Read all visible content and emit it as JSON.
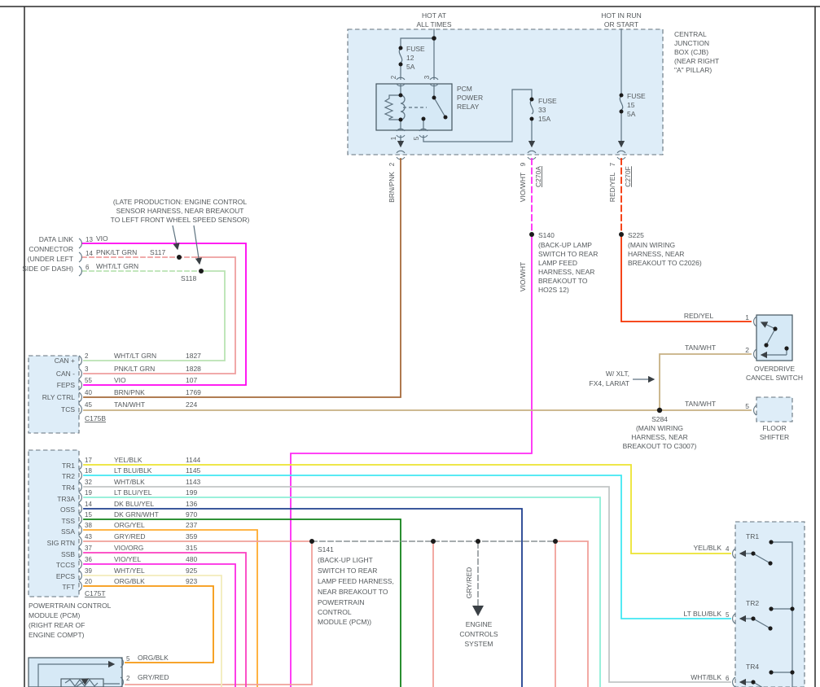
{
  "wire_colors": {
    "vio": "#ff00f0",
    "vio_wht": "#ff2af5",
    "pnk_lt_grn": "#ee9e9e",
    "wht_lt_grn": "#b9e3b2",
    "brn_pnk": "#a5693a",
    "tan_wht": "#c7b083",
    "red_yel": "#f53000",
    "yel_blk": "#ece431",
    "lt_blu_blk": "#41e8f2",
    "wht_blk": "#c2c6c6",
    "lt_blu_yel": "#8deed6",
    "dk_blu_yel": "#20408f",
    "dk_grn_wht": "#12821a",
    "org_yel": "#ffab2e",
    "gry_red": "#f0a09a",
    "gry_red_bus": "#9aa0a3",
    "vio_org": "#fb3fc1",
    "vio_yel": "#fd2ae4",
    "wht_yel": "#f2ecbb",
    "org_blk": "#f6980f"
  },
  "ui_colors": {
    "box_fill": "#deedf8",
    "box_border": "#64727c",
    "wire_gray": "#5d7280",
    "text": "#54595c",
    "frame": "#2a2a2a"
  },
  "header": {
    "hot_left": [
      "HOT AT",
      "ALL TIMES"
    ],
    "hot_right": [
      "HOT IN RUN",
      "OR START"
    ],
    "cjb_title": [
      "CENTRAL",
      "JUNCTION",
      "BOX (CJB)",
      "(NEAR RIGHT",
      "\"A\" PILLAR)"
    ]
  },
  "fuses": {
    "f12": [
      "FUSE",
      "12",
      "5A"
    ],
    "f33": [
      "FUSE",
      "33",
      "15A"
    ],
    "f15": [
      "FUSE",
      "15",
      "5A"
    ]
  },
  "relay": {
    "name": [
      "PCM",
      "POWER",
      "RELAY"
    ],
    "pins": {
      "tl": "2",
      "tr": "3",
      "bl": "1",
      "bm": "5"
    }
  },
  "exits": {
    "brn_pnk": {
      "wire": "BRN/PNK",
      "pin": "2"
    },
    "vio_wht": {
      "wire": "VIO/WHT",
      "pin": "9",
      "conn": "C270A"
    },
    "red_yel": {
      "wire": "RED/YEL",
      "pin": "7",
      "conn": "C270F"
    }
  },
  "splices": {
    "s117": "S117",
    "s118": "S118",
    "s140": {
      "name": "S140",
      "wire": "VIO/WHT",
      "lines": [
        "(BACK-UP LAMP",
        "SWITCH TO REAR",
        "LAMP FEED",
        "HARNESS, NEAR",
        "BREAKOUT TO",
        "HO2S 12)"
      ]
    },
    "s225": {
      "name": "S225",
      "lines": [
        "(MAIN WIRING",
        "HARNESS, NEAR",
        "BREAKOUT TO C2026)"
      ]
    },
    "s284": {
      "name": "S284",
      "lines": [
        "(MAIN WIRING",
        "HARNESS, NEAR",
        "BREAKOUT TO C3007)"
      ]
    },
    "s141": {
      "name": "S141",
      "lines": [
        "(BACK-UP LIGHT",
        "SWITCH TO REAR",
        "LAMP FEED HARNESS,",
        "NEAR BREAKOUT TO",
        "POWERTRAIN",
        "CONTROL",
        "MODULE (PCM))"
      ]
    }
  },
  "note": [
    "(LATE PRODUCTION: ENGINE CONTROL",
    "SENSOR HARNESS, NEAR BREAKOUT",
    "TO LEFT FRONT WHEEL SPEED SENSOR)"
  ],
  "dlc": {
    "title": [
      "DATA LINK",
      "CONNECTOR",
      "(UNDER LEFT",
      "SIDE OF DASH)"
    ],
    "pins": [
      {
        "pin": "13",
        "wire": "VIO"
      },
      {
        "pin": "14",
        "wire": "PNK/LT GRN"
      },
      {
        "pin": "6",
        "wire": "WHT/LT GRN"
      }
    ]
  },
  "c175b": {
    "name": "C175B",
    "rows": [
      {
        "label": "CAN +",
        "pin": "2",
        "wire": "WHT/LT GRN",
        "circuit": "1827"
      },
      {
        "label": "CAN -",
        "pin": "3",
        "wire": "PNK/LT GRN",
        "circuit": "1828"
      },
      {
        "label": "FEPS",
        "pin": "55",
        "wire": "VIO",
        "circuit": "107"
      },
      {
        "label": "RLY CTRL",
        "pin": "40",
        "wire": "BRN/PNK",
        "circuit": "1769"
      },
      {
        "label": "TCS",
        "pin": "45",
        "wire": "TAN/WHT",
        "circuit": "224"
      }
    ]
  },
  "c175t": {
    "name": "C175T",
    "rows": [
      {
        "label": "TR1",
        "pin": "17",
        "wire": "YEL/BLK",
        "circuit": "1144"
      },
      {
        "label": "TR2",
        "pin": "18",
        "wire": "LT BLU/BLK",
        "circuit": "1145"
      },
      {
        "label": "TR4",
        "pin": "32",
        "wire": "WHT/BLK",
        "circuit": "1143"
      },
      {
        "label": "TR3A",
        "pin": "19",
        "wire": "LT BLU/YEL",
        "circuit": "199"
      },
      {
        "label": "OSS",
        "pin": "14",
        "wire": "DK BLU/YEL",
        "circuit": "136"
      },
      {
        "label": "TSS",
        "pin": "15",
        "wire": "DK GRN/WHT",
        "circuit": "970"
      },
      {
        "label": "SSA",
        "pin": "38",
        "wire": "ORG/YEL",
        "circuit": "237"
      },
      {
        "label": "SIG RTN",
        "pin": "43",
        "wire": "GRY/RED",
        "circuit": "359"
      },
      {
        "label": "SSB",
        "pin": "37",
        "wire": "VIO/ORG",
        "circuit": "315"
      },
      {
        "label": "TCCS",
        "pin": "36",
        "wire": "VIO/YEL",
        "circuit": "480"
      },
      {
        "label": "EPCS",
        "pin": "39",
        "wire": "WHT/YEL",
        "circuit": "925"
      },
      {
        "label": "TFT",
        "pin": "20",
        "wire": "ORG/BLK",
        "circuit": "923"
      }
    ]
  },
  "pcm_label": [
    "POWERTRAIN CONTROL",
    "MODULE (PCM)",
    "(RIGHT REAR OF",
    "ENGINE COMPT)"
  ],
  "od_switch": {
    "title": [
      "OVERDRIVE",
      "CANCEL SWITCH"
    ],
    "pin1": "1",
    "pin2": "2",
    "wire1": "RED/YEL",
    "wire2": "TAN/WHT"
  },
  "floor_shifter": {
    "title": [
      "FLOOR",
      "SHIFTER"
    ],
    "pin": "5",
    "wire": "TAN/WHT"
  },
  "variant": [
    "W/ XLT,",
    "FX4, LARIAT"
  ],
  "engine_controls": {
    "wire": "GRY/RED",
    "lines": [
      "ENGINE",
      "CONTROLS",
      "SYSTEM"
    ]
  },
  "tr_switch": {
    "items": [
      {
        "name": "TR1",
        "wire": "YEL/BLK",
        "pin": "4"
      },
      {
        "name": "TR2",
        "wire": "LT BLU/BLK",
        "pin": "5"
      },
      {
        "name": "TR4",
        "wire": "WHT/BLK",
        "pin": "6"
      }
    ]
  },
  "tft_sensor": {
    "pins": [
      {
        "pin": "5",
        "wire": "ORG/BLK"
      },
      {
        "pin": "2",
        "wire": "GRY/RED"
      }
    ]
  }
}
